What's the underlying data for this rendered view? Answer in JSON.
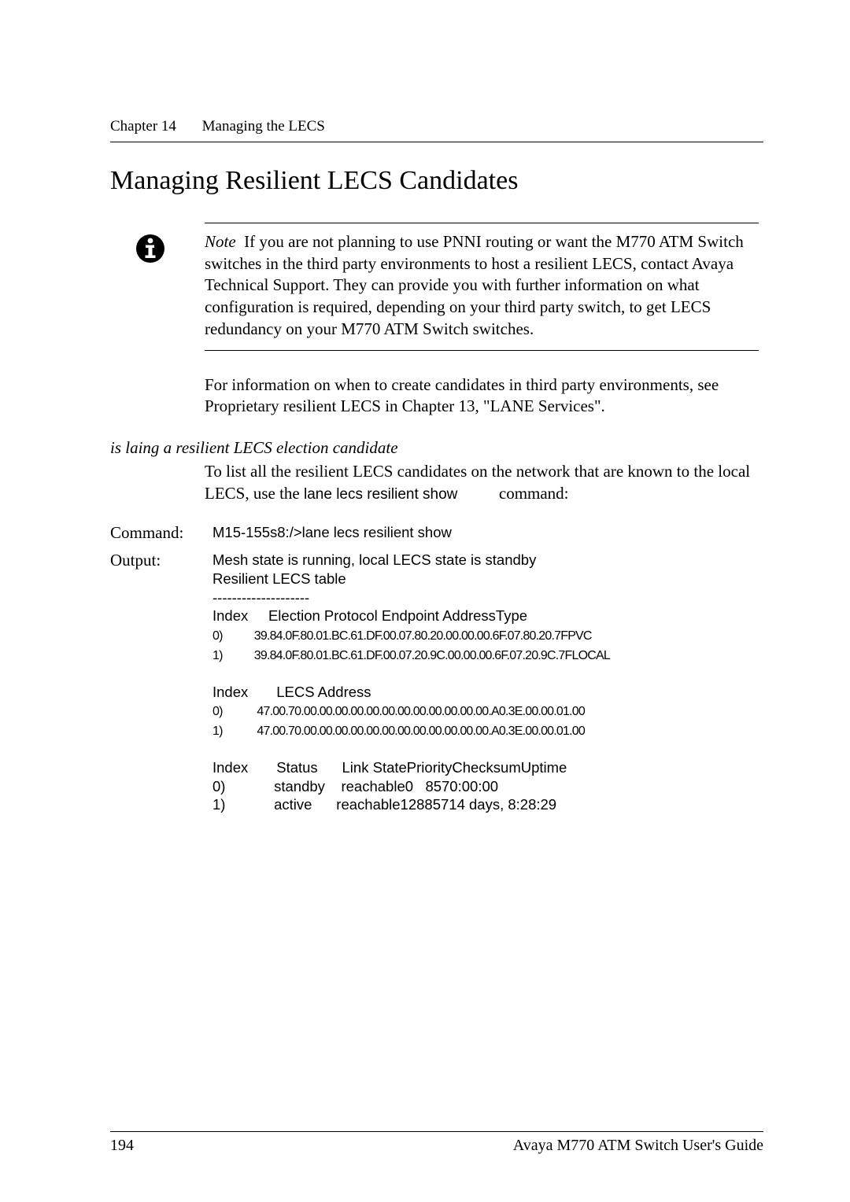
{
  "running_head": {
    "chapter": "Chapter 14",
    "title": "Managing the LECS"
  },
  "h1": "Managing Resilient LECS Candidates",
  "note": {
    "label": "Note",
    "text": "If you are not planning to use PNNI routing or want the M770 ATM Switch switches in the third party environments to host a resilient LECS, contact Avaya Technical Support. They can provide you with further information on what configuration is required, depending on your third party switch, to get LECS redundancy on your M770 ATM Switch switches."
  },
  "para_after_note": "For information on when to create candidates in third party environments, see Proprietary resilient LECS in Chapter 13, \"LANE Services\".",
  "h3_combined": " is laing a resilient LECS election candidate",
  "para2_pre": "To list all the resilient LECS candidates on the network that are known to the local LECS, use the ",
  "para2_cmd": "lane lecs resilient show",
  "para2_post": " command:",
  "command": {
    "label": "Command:",
    "value": "M15-155s8:/>lane lecs resilient show"
  },
  "output": {
    "label": "Output:",
    "lines": [
      "Mesh state is running, local LECS state is standby",
      "Resilient LECS table",
      "--------------------",
      "Index     Election Protocol Endpoint AddressType",
      "0)           39.84.0F.80.01.BC.61.DF.00.07.80.20.00.00.00.6F.07.80.20.7FPVC",
      "1)           39.84.0F.80.01.BC.61.DF.00.07.20.9C.00.00.00.6F.07.20.9C.7FLOCAL",
      "",
      "Index       LECS Address",
      "0)            47.00.70.00.00.00.00.00.00.00.00.00.00.00.00.A0.3E.00.00.01.00",
      "1)            47.00.70.00.00.00.00.00.00.00.00.00.00.00.00.A0.3E.00.00.01.00",
      "",
      "Index       Status      Link StatePriorityChecksumUptime",
      "0)            standby    reachable0   8570:00:00",
      "1)            active      reachable12885714 days, 8:28:29"
    ]
  },
  "footer": {
    "pageno": "194",
    "doc": "Avaya M770 ATM Switch User's Guide"
  }
}
